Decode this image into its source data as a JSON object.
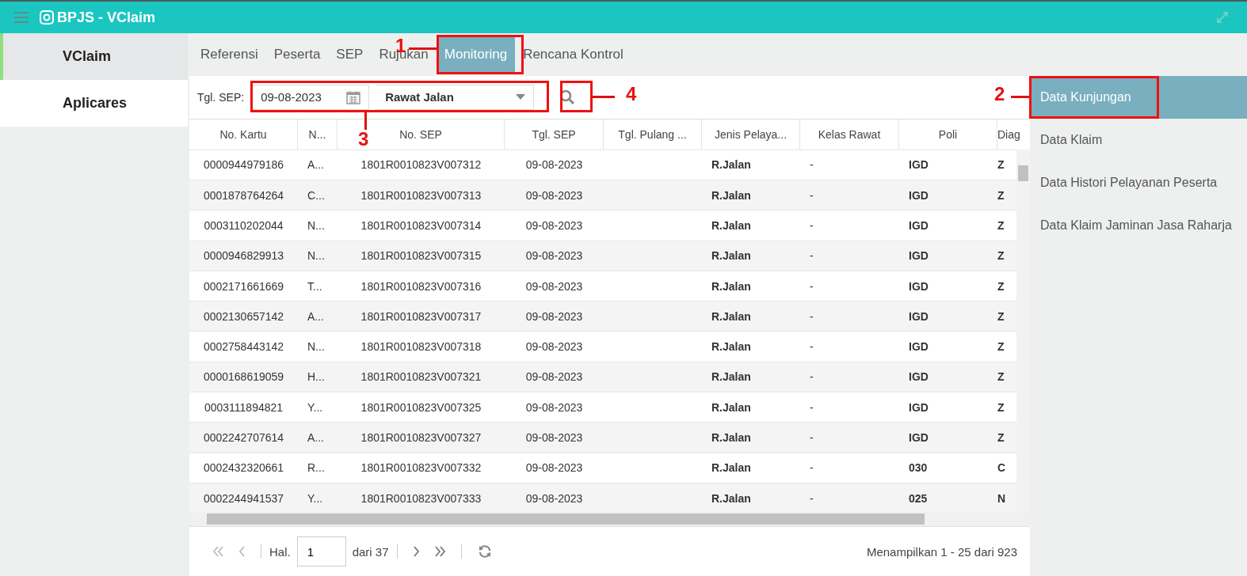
{
  "app": {
    "title": "BPJS - VClaim"
  },
  "sidebar": {
    "items": [
      {
        "label": "VClaim",
        "selected": true
      },
      {
        "label": "Aplicares",
        "selected": false
      }
    ]
  },
  "tabs": [
    {
      "label": "Referensi",
      "selected": false
    },
    {
      "label": "Peserta",
      "selected": false
    },
    {
      "label": "SEP",
      "selected": false
    },
    {
      "label": "Rujukan",
      "selected": false
    },
    {
      "label": "Monitoring",
      "selected": true
    },
    {
      "label": "Rencana Kontrol",
      "selected": false
    }
  ],
  "filter": {
    "label": "Tgl. SEP:",
    "date": "09-08-2023",
    "service": "Rawat Jalan"
  },
  "table": {
    "columns": [
      "No. Kartu",
      "N...",
      "No. SEP",
      "Tgl. SEP",
      "Tgl. Pulang ...",
      "Jenis Pelaya...",
      "Kelas Rawat",
      "Poli",
      "Diag"
    ],
    "rows": [
      [
        "0000944979186",
        "A...",
        "1801R0010823V007312",
        "09-08-2023",
        "",
        "R.Jalan",
        "-",
        "IGD",
        "Z"
      ],
      [
        "0001878764264",
        "C...",
        "1801R0010823V007313",
        "09-08-2023",
        "",
        "R.Jalan",
        "-",
        "IGD",
        "Z"
      ],
      [
        "0003110202044",
        "N...",
        "1801R0010823V007314",
        "09-08-2023",
        "",
        "R.Jalan",
        "-",
        "IGD",
        "Z"
      ],
      [
        "0000946829913",
        "N...",
        "1801R0010823V007315",
        "09-08-2023",
        "",
        "R.Jalan",
        "-",
        "IGD",
        "Z"
      ],
      [
        "0002171661669",
        "T...",
        "1801R0010823V007316",
        "09-08-2023",
        "",
        "R.Jalan",
        "-",
        "IGD",
        "Z"
      ],
      [
        "0002130657142",
        "A...",
        "1801R0010823V007317",
        "09-08-2023",
        "",
        "R.Jalan",
        "-",
        "IGD",
        "Z"
      ],
      [
        "0002758443142",
        "N...",
        "1801R0010823V007318",
        "09-08-2023",
        "",
        "R.Jalan",
        "-",
        "IGD",
        "Z"
      ],
      [
        "0000168619059",
        "H...",
        "1801R0010823V007321",
        "09-08-2023",
        "",
        "R.Jalan",
        "-",
        "IGD",
        "Z"
      ],
      [
        "0003111894821",
        "Y...",
        "1801R0010823V007325",
        "09-08-2023",
        "",
        "R.Jalan",
        "-",
        "IGD",
        "Z"
      ],
      [
        "0002242707614",
        "A...",
        "1801R0010823V007327",
        "09-08-2023",
        "",
        "R.Jalan",
        "-",
        "IGD",
        "Z"
      ],
      [
        "0002432320661",
        "R...",
        "1801R0010823V007332",
        "09-08-2023",
        "",
        "R.Jalan",
        "-",
        "030",
        "C"
      ],
      [
        "0002244941537",
        "Y...",
        "1801R0010823V007333",
        "09-08-2023",
        "",
        "R.Jalan",
        "-",
        "025",
        "N"
      ]
    ]
  },
  "pager": {
    "page_label": "Hal.",
    "page": "1",
    "of": "dari 37",
    "summary": "Menampilkan 1 - 25 dari 923"
  },
  "menu": {
    "items": [
      {
        "label": "Data Kunjungan",
        "selected": true
      },
      {
        "label": "Data Klaim",
        "selected": false
      },
      {
        "label": "Data Histori Pelayanan Peserta",
        "selected": false
      },
      {
        "label": "Data Klaim Jaminan Jasa Raharja",
        "selected": false
      }
    ]
  },
  "annotations": [
    "1",
    "2",
    "3",
    "4"
  ]
}
